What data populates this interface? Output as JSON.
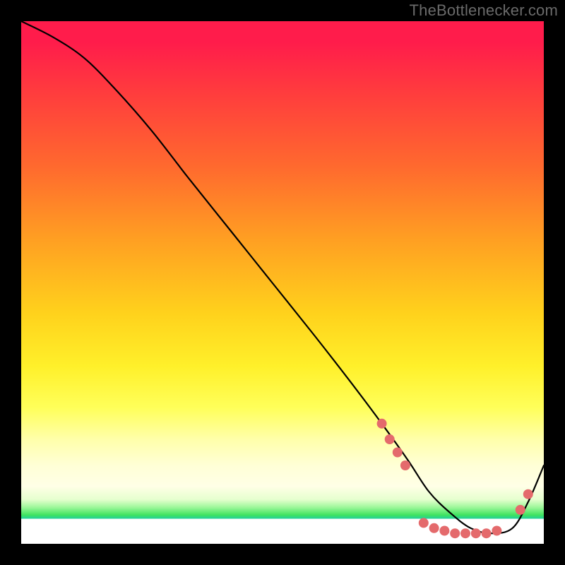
{
  "attribution": "TheBottlenecker.com",
  "chart_data": {
    "type": "line",
    "title": "",
    "xlabel": "",
    "ylabel": "",
    "xlim": [
      0,
      100
    ],
    "ylim": [
      0,
      100
    ],
    "series": [
      {
        "name": "bottleneck-curve",
        "x": [
          0,
          6,
          12,
          18,
          25,
          32,
          40,
          48,
          56,
          63,
          69,
          74,
          78,
          82,
          86,
          90,
          94,
          97,
          100
        ],
        "y": [
          100,
          97,
          93,
          87,
          79,
          70,
          60,
          50,
          40,
          31,
          23,
          16,
          10,
          6,
          3,
          2,
          3,
          8,
          15
        ]
      }
    ],
    "markers": [
      {
        "x": 69.0,
        "y": 23.0
      },
      {
        "x": 70.5,
        "y": 20.0
      },
      {
        "x": 72.0,
        "y": 17.5
      },
      {
        "x": 73.5,
        "y": 15.0
      },
      {
        "x": 77.0,
        "y": 4.0
      },
      {
        "x": 79.0,
        "y": 3.0
      },
      {
        "x": 81.0,
        "y": 2.5
      },
      {
        "x": 83.0,
        "y": 2.0
      },
      {
        "x": 85.0,
        "y": 2.0
      },
      {
        "x": 87.0,
        "y": 2.0
      },
      {
        "x": 89.0,
        "y": 2.0
      },
      {
        "x": 91.0,
        "y": 2.5
      },
      {
        "x": 95.5,
        "y": 6.5
      },
      {
        "x": 97.0,
        "y": 9.5
      }
    ],
    "marker_style": {
      "color": "#e46a6c",
      "radius_px": 7
    },
    "gradient_stops": [
      {
        "pct": 0,
        "color": "#ff1c4b"
      },
      {
        "pct": 28,
        "color": "#ff6a2e"
      },
      {
        "pct": 56,
        "color": "#ffd21c"
      },
      {
        "pct": 80,
        "color": "#ffffaa"
      },
      {
        "pct": 94,
        "color": "#3fe35f"
      },
      {
        "pct": 100,
        "color": "#ffffff"
      }
    ]
  }
}
